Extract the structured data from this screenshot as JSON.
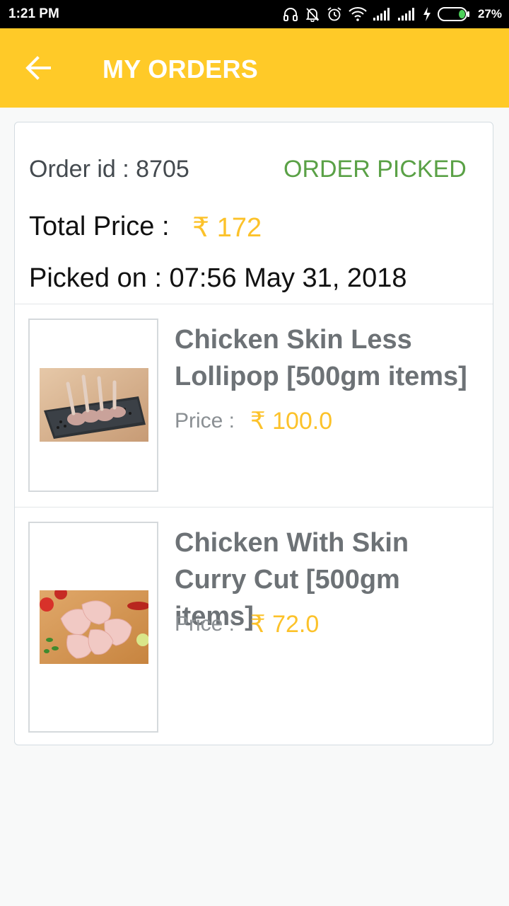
{
  "status_bar": {
    "time": "1:21 PM",
    "battery": "27%"
  },
  "app_bar": {
    "title": "MY ORDERS"
  },
  "order": {
    "id_text": "Order id : 8705",
    "status": "ORDER PICKED",
    "total_label": "Total Price :",
    "total_value": "₹ 172",
    "picked_on": "Picked on : 07:56 May 31, 2018",
    "items": [
      {
        "name": "Chicken Skin Less Lollipop [500gm items]",
        "price_label": "Price :",
        "price_value": "₹ 100.0"
      },
      {
        "name": "Chicken With Skin Curry Cut [500gm items]",
        "price_label": "Price :",
        "price_value": "₹ 72.0"
      }
    ]
  },
  "colors": {
    "app_bar": "#ffca28",
    "status_green": "#5aa146",
    "price_yellow": "#fcc22a"
  }
}
